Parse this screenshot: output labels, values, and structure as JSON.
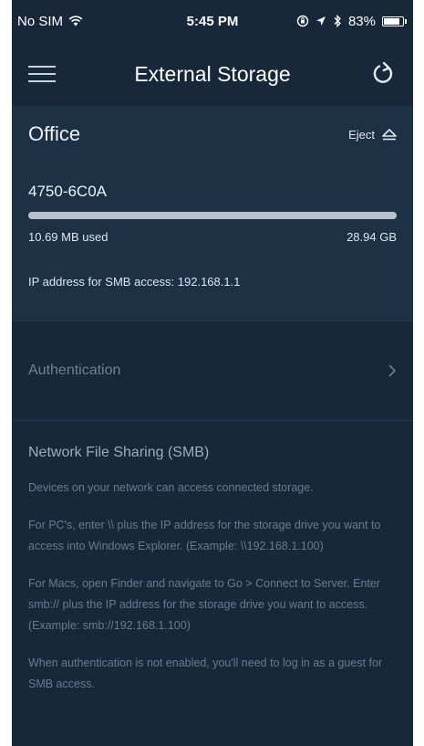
{
  "status_bar": {
    "carrier": "No SIM",
    "time": "5:45 PM",
    "battery_percent": "83%",
    "battery_level": 0.83
  },
  "header": {
    "title": "External Storage"
  },
  "storage": {
    "location": "Office",
    "eject_label": "Eject",
    "drive_name": "4750-6C0A",
    "used": "10.69 MB used",
    "total": "28.94 GB",
    "usage_fraction": 0.0004,
    "ip_line": "IP address for SMB access: 192.168.1.1"
  },
  "authentication": {
    "label": "Authentication"
  },
  "smb": {
    "title": "Network File Sharing (SMB)",
    "paragraphs": [
      "Devices on your network can access connected storage.",
      "For PC's, enter \\\\ plus the IP address for the storage drive you want to access into Windows Explorer. (Example: \\\\192.168.1.100)",
      "For Macs, open Finder and navigate to Go > Connect to Server. Enter smb:// plus the IP address for the storage drive you want to access. (Example: smb://192.168.1.100)",
      "When authentication is not enabled, you'll need to log in as a guest for SMB access."
    ]
  },
  "colors": {
    "background": "#17283a",
    "card": "#1c3146",
    "muted_text": "#687b90"
  }
}
